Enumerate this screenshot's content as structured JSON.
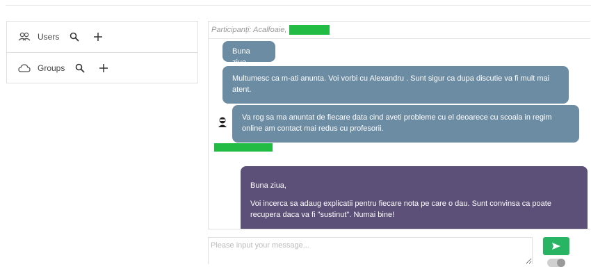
{
  "sidebar": {
    "items": [
      {
        "label": "Users",
        "icon": "users-icon"
      },
      {
        "label": "Groups",
        "icon": "cloud-icon"
      }
    ]
  },
  "chat": {
    "participants_label": "Participanți: Acalfoaie,",
    "messages": [
      {
        "direction": "incoming",
        "paragraphs": [
          "Buna ziua,"
        ]
      },
      {
        "direction": "incoming",
        "paragraphs": [
          "Multumesc ca m-ati anunta. Voi vorbi cu Alexandru . Sunt sigur ca dupa discutie va fi mult mai atent."
        ]
      },
      {
        "direction": "incoming",
        "paragraphs": [
          "Va rog sa ma anuntat de fiecare data cind aveti probleme cu el deoarece cu scoala in regim online am contact mai redus cu profesorii."
        ]
      },
      {
        "direction": "outgoing",
        "paragraphs": [
          "Buna ziua,",
          "Voi incerca sa adaug explicatii pentru fiecare nota pe care o dau. Sunt convinsa ca poate recupera daca va fi \"sustinut\". Numai bine!"
        ]
      }
    ]
  },
  "composer": {
    "placeholder": "Please input your message..."
  },
  "colors": {
    "incoming_bubble": "#6c8ca4",
    "outgoing_bubble": "#5c5079",
    "send_button": "#28b463",
    "redaction": "#22bb44"
  }
}
